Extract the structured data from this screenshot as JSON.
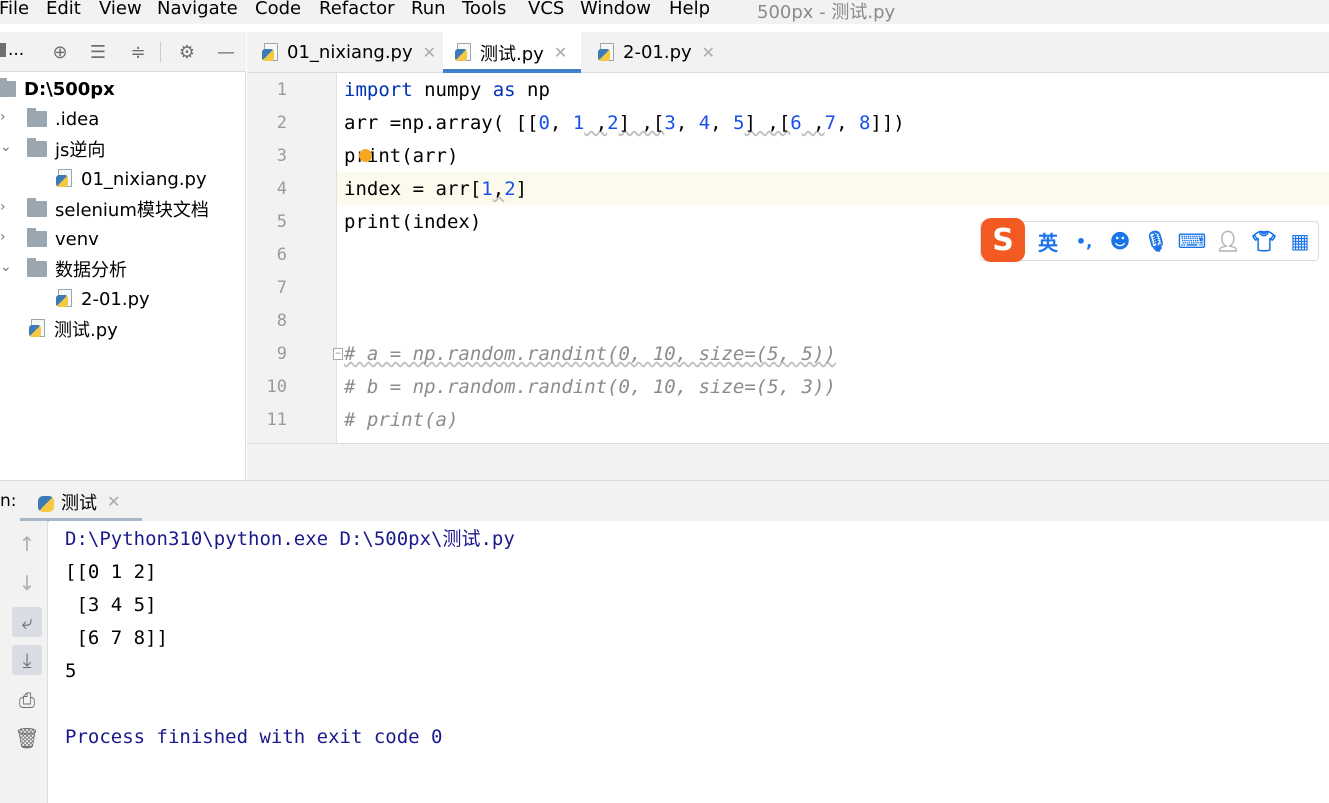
{
  "menu": {
    "items": [
      "File",
      "Edit",
      "View",
      "Navigate",
      "Code",
      "Refactor",
      "Run",
      "Tools",
      "VCS",
      "Window",
      "Help"
    ],
    "window_title": "500px - 测试.py"
  },
  "project_panel": {
    "title": "..."
  },
  "tree": [
    {
      "label": "D:\\500px",
      "type": "root-folder"
    },
    {
      "label": ".idea",
      "type": "folder"
    },
    {
      "label": "js逆向",
      "type": "folder"
    },
    {
      "label": "01_nixiang.py",
      "type": "python-file"
    },
    {
      "label": "selenium模块文档",
      "type": "folder"
    },
    {
      "label": "venv",
      "type": "folder"
    },
    {
      "label": "数据分析",
      "type": "folder"
    },
    {
      "label": "2-01.py",
      "type": "python-file"
    },
    {
      "label": "测试.py",
      "type": "python-file"
    }
  ],
  "tabs": [
    {
      "label": "01_nixiang.py",
      "active": false
    },
    {
      "label": "测试.py",
      "active": true
    },
    {
      "label": "2-01.py",
      "active": false
    }
  ],
  "editor": {
    "line_numbers": [
      "1",
      "2",
      "3",
      "4",
      "5",
      "6",
      "7",
      "8",
      "9",
      "10",
      "11"
    ],
    "code": {
      "l1_kw1": "import",
      "l1_mid": " numpy ",
      "l1_kw2": "as",
      "l1_end": " np",
      "l2_a": "arr =np.array( [[",
      "l2_n0": "0",
      "l2_c1": ", ",
      "l2_n1": "1",
      "l2_c2": " ,",
      "l2_n2": "2",
      "l2_c3": "] ,[",
      "l2_n3": "3",
      "l2_c4": ", ",
      "l2_n4": "4",
      "l2_c5": ", ",
      "l2_n5": "5",
      "l2_c6": "] ,[",
      "l2_n6": "6",
      "l2_c7": " ,",
      "l2_n7": "7",
      "l2_c8": ", ",
      "l2_n8": "8",
      "l2_c9": "]])",
      "l3": "print(arr)",
      "l4_a": "index = arr[",
      "l4_n1": "1",
      "l4_c": ",",
      "l4_n2": "2",
      "l4_b": "]",
      "l5": "print(index)",
      "l9": "# a = np.random.randint(0, 10, size=(5, 5))",
      "l10": "# b = np.random.randint(0, 10, size=(5, 3))",
      "l11": "# print(a)"
    }
  },
  "ime": {
    "logo": "S",
    "lang": "英",
    "punct": "•,"
  },
  "run_panel": {
    "label": "n:",
    "tab_label": "测试",
    "output": [
      "D:\\Python310\\python.exe D:\\500px\\测试.py",
      "[[0 1 2]",
      " [3 4 5]",
      " [6 7 8]]",
      "5",
      "",
      "Process finished with exit code 0"
    ]
  },
  "colors": {
    "keyword": "#0033b3",
    "number": "#1750eb",
    "comment": "#8c8c8c",
    "active_tab_underline": "#4083c9",
    "ime_accent": "#1a73e8",
    "ime_logo": "#f25a22"
  },
  "icons": [
    "globe-icon",
    "expand-all-icon",
    "collapse-all-icon",
    "gear-icon",
    "minimize-icon",
    "arrow-up-icon",
    "arrow-down-icon",
    "soft-wrap-icon",
    "scroll-to-end-icon",
    "print-icon",
    "trash-icon"
  ]
}
